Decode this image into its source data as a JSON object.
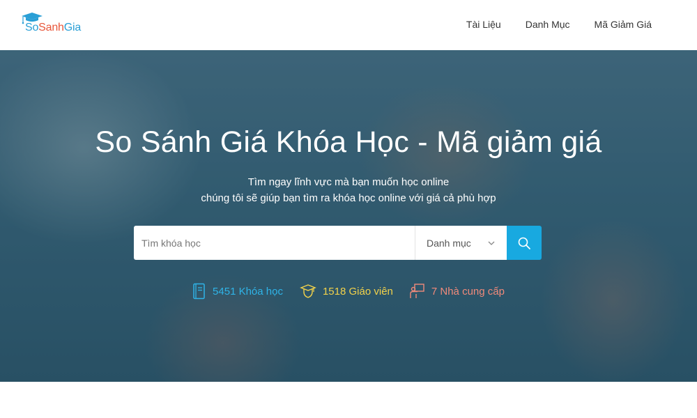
{
  "header": {
    "logo": {
      "part_so": "So",
      "part_sanh": "Sanh",
      "part_gia": "Gia"
    },
    "nav": [
      {
        "label": "Tài Liệu"
      },
      {
        "label": "Danh Mục"
      },
      {
        "label": "Mã Giảm Giá"
      }
    ]
  },
  "hero": {
    "title": "So Sánh Giá Khóa Học - Mã giảm giá",
    "subtitle_line1": "Tìm ngay lĩnh vực mà bạn muốn học online",
    "subtitle_line2": "chúng tôi sẽ giúp bạn tìm ra khóa học online với giá cả phù hợp"
  },
  "search": {
    "placeholder": "Tìm khóa học",
    "value": "",
    "category_selected": "Danh mục",
    "button_icon": "search-icon"
  },
  "stats": [
    {
      "text": "5451 Khóa học",
      "icon": "book-icon",
      "color": "#2fb4e8"
    },
    {
      "text": "1518 Giáo viên",
      "icon": "graduate-icon",
      "color": "#f2d24a"
    },
    {
      "text": "7 Nhà cung cấp",
      "icon": "presenter-icon",
      "color": "#f08a7a"
    }
  ],
  "colors": {
    "brand_blue": "#2a9fd6",
    "brand_orange": "#e8563a",
    "search_button": "#18a9e0"
  }
}
